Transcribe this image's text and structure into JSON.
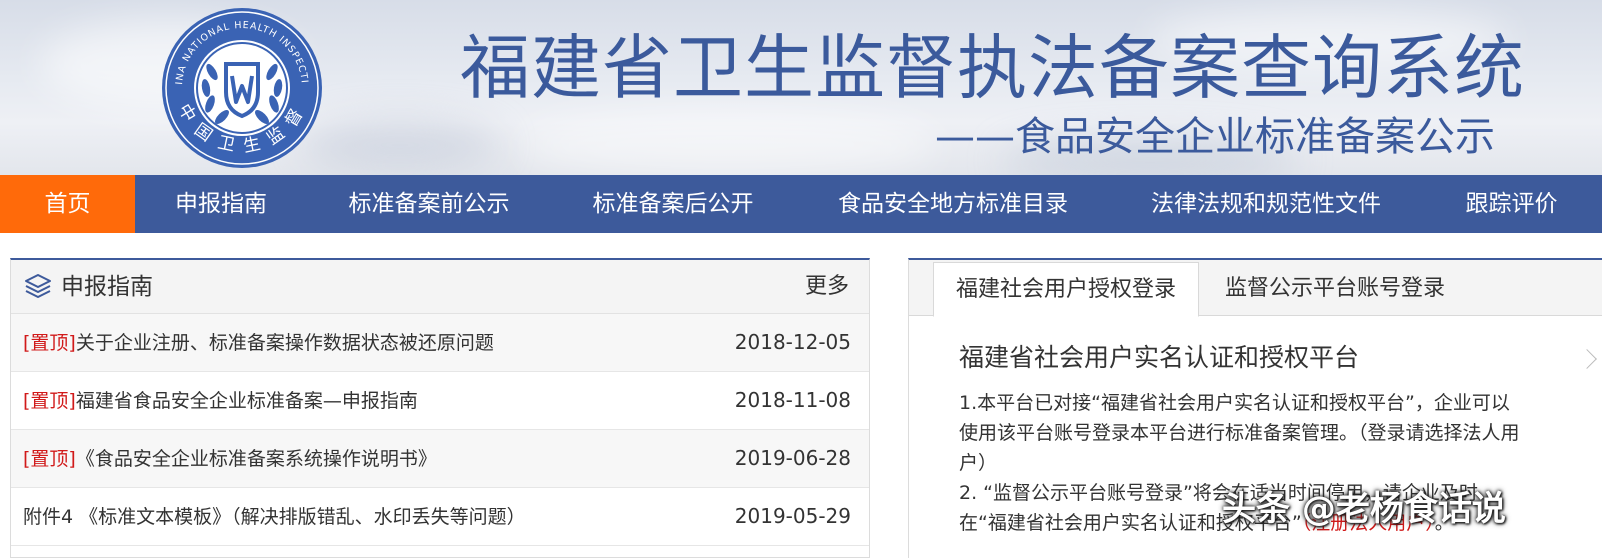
{
  "header": {
    "site_title": "福建省卫生监督执法备案查询系统",
    "site_subtitle": "——食品安全企业标准备案公示",
    "emblem": {
      "ring_text": "CHINA NATIONAL HEALTH INSPECTION",
      "bottom_text": "中国卫生监督"
    }
  },
  "nav": {
    "items": [
      {
        "label": "首页",
        "active": true
      },
      {
        "label": "申报指南",
        "active": false
      },
      {
        "label": "标准备案前公示",
        "active": false
      },
      {
        "label": "标准备案后公开",
        "active": false
      },
      {
        "label": "食品安全地方标准目录",
        "active": false
      },
      {
        "label": "法律法规和规范性文件",
        "active": false
      },
      {
        "label": "跟踪评价",
        "active": false
      }
    ]
  },
  "guide_panel": {
    "icon": "layers-icon",
    "title": "申报指南",
    "more_label": "更多",
    "items": [
      {
        "pin": "[置顶]",
        "text": "关于企业注册、标准备案操作数据状态被还原问题",
        "date": "2018-12-05"
      },
      {
        "pin": "[置顶]",
        "text": "福建省食品安全企业标准备案—申报指南",
        "date": "2018-11-08"
      },
      {
        "pin": "[置顶]",
        "text": "《食品安全企业标准备案系统操作说明书》",
        "date": "2019-06-28"
      },
      {
        "pin": "",
        "text": "附件4 《标准文本模板》（解决排版错乱、水印丢失等问题）",
        "date": "2019-05-29"
      }
    ]
  },
  "login_panel": {
    "tabs": [
      {
        "label": "福建社会用户授权登录",
        "active": true
      },
      {
        "label": "监督公示平台账号登录",
        "active": false
      }
    ],
    "title": "福建省社会用户实名认证和授权平台",
    "para1": "1.本平台已对接“福建省社会用户实名认证和授权平台”，企业可以使用该平台账号登录本平台进行标准备案管理。（登录请选择法人用户）",
    "para2_before": "2. “监督公示平台账号登录”将会在适当时间停用，请企业及时在“福建省社会用户实名认证和授权平台”",
    "para2_link": "（注册法人用户）",
    "para2_after": "。"
  },
  "watermark": "头条 @老杨食话说",
  "colors": {
    "nav_bg": "#3d5a9b",
    "nav_active": "#ff6a0a",
    "title_blue": "#3b5a9c",
    "pin_red": "#d11a1a"
  }
}
